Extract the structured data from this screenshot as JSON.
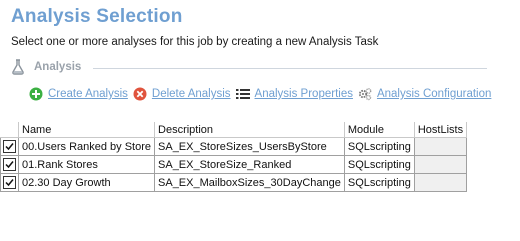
{
  "header": {
    "title": "Analysis Selection",
    "subtitle": "Select one or more analyses for this job by creating a new Analysis Task"
  },
  "section": {
    "label": "Analysis",
    "icon": "flask-icon"
  },
  "toolbar": {
    "create_label": "Create Analysis",
    "delete_label": "Delete Analysis",
    "properties_label": "Analysis Properties",
    "configuration_label": "Analysis Configuration"
  },
  "table": {
    "columns": [
      "Name",
      "Description",
      "Module",
      "HostLists"
    ],
    "rows": [
      {
        "checked": true,
        "name": "00.Users Ranked by Store",
        "description": "SA_EX_StoreSizes_UsersByStore",
        "module": "SQLscripting",
        "hostlists": ""
      },
      {
        "checked": true,
        "name": "01.Rank Stores",
        "description": "SA_EX_StoreSize_Ranked",
        "module": "SQLscripting",
        "hostlists": ""
      },
      {
        "checked": true,
        "name": "02.30 Day Growth",
        "description": "SA_EX_MailboxSizes_30DayChange",
        "module": "SQLscripting",
        "hostlists": ""
      }
    ]
  },
  "colors": {
    "title": "#6f9fd1",
    "link": "#6f9fd1",
    "create_icon": "#3cb043",
    "delete_icon": "#e0533d"
  }
}
